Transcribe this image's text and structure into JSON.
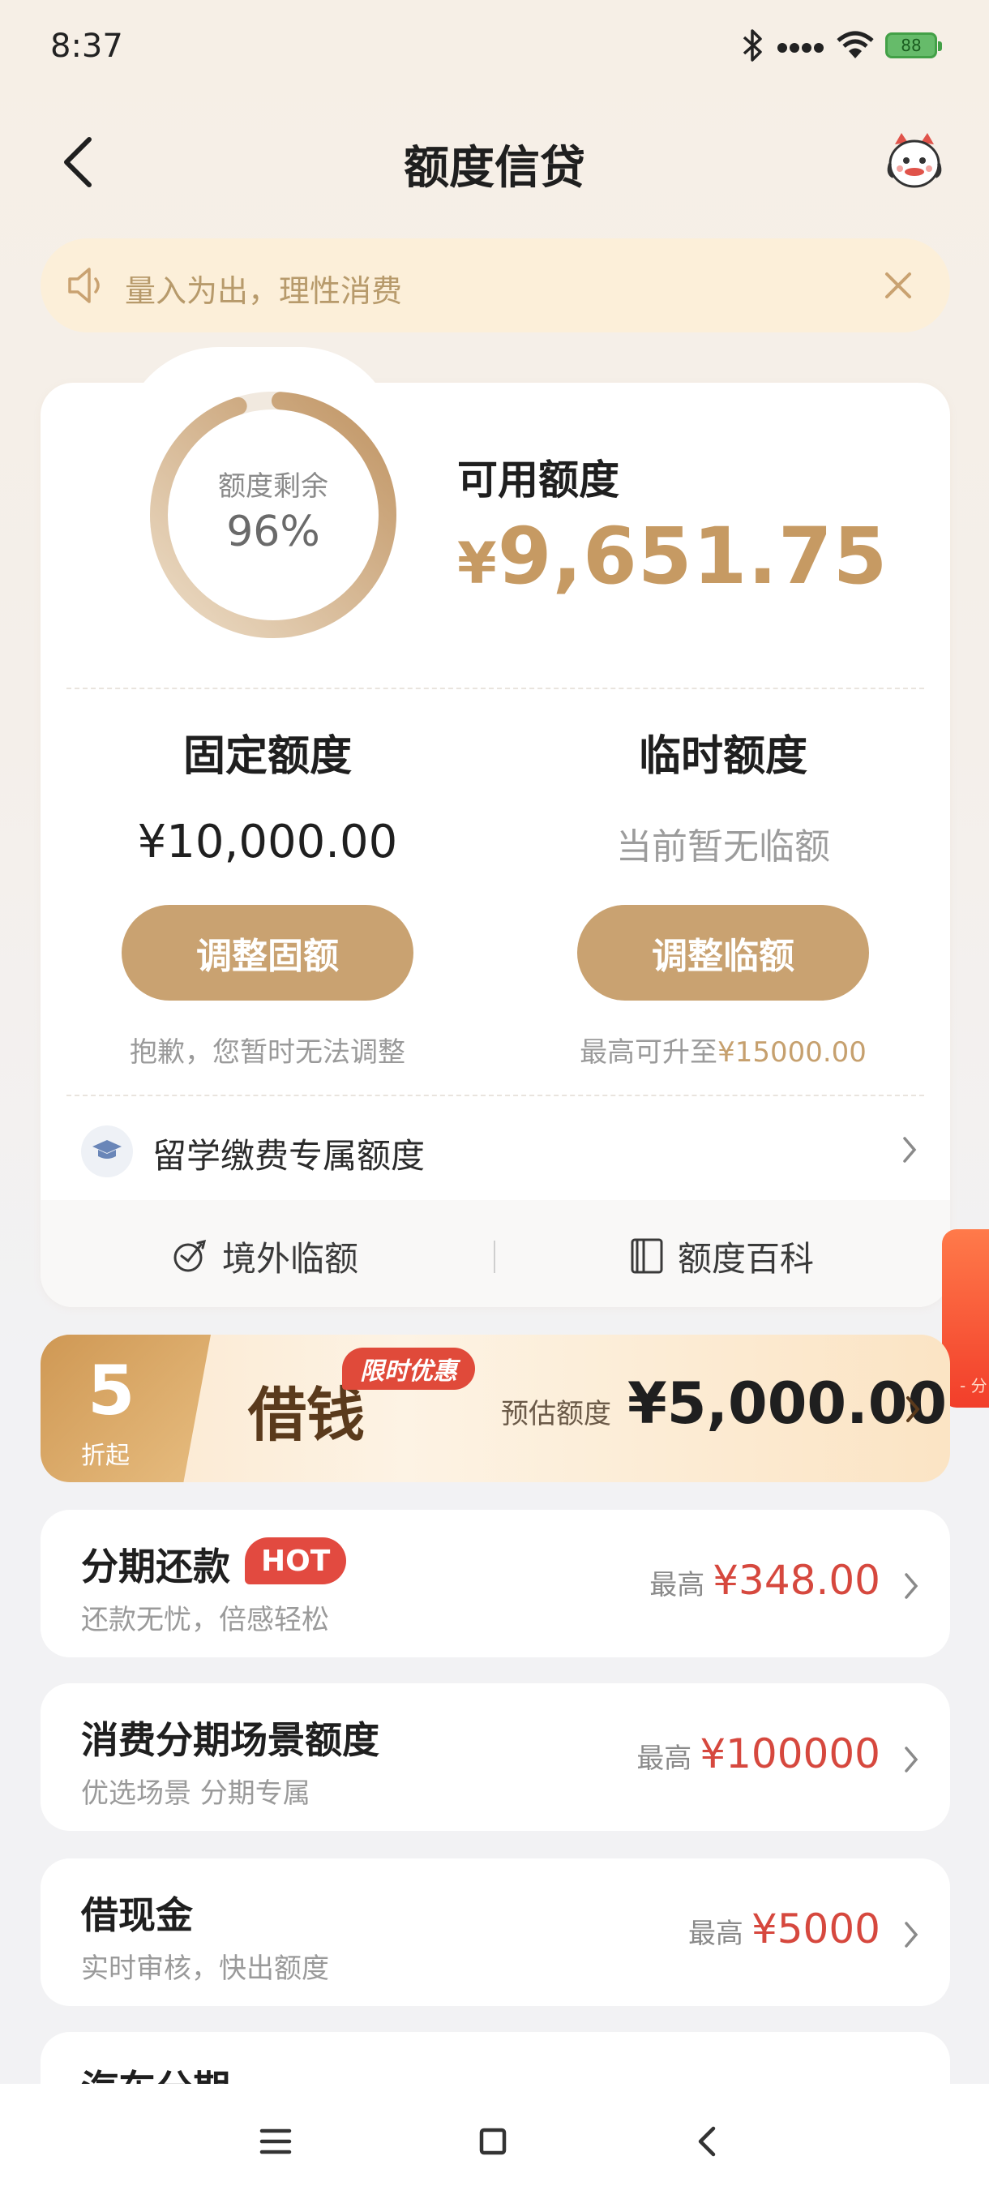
{
  "status_bar": {
    "time": "8:37",
    "battery": "88"
  },
  "header": {
    "title": "额度信贷"
  },
  "notice": {
    "text": "量入为出，理性消费"
  },
  "credit": {
    "ring_label": "额度剩余",
    "ring_percent": "96%",
    "ring_fraction": 0.96,
    "available_title": "可用额度",
    "available_currency": "¥",
    "available_amount": "9,651.75",
    "fixed_title": "固定额度",
    "fixed_amount": "¥10,000.00",
    "fixed_button": "调整固额",
    "fixed_hint": "抱歉，您暂时无法调整",
    "temp_title": "临时额度",
    "temp_status": "当前暂无临额",
    "temp_button": "调整临额",
    "temp_hint_prefix": "最高可升至",
    "temp_hint_amount": "¥15000.00",
    "study_label": "留学缴费专属额度",
    "overseas_link": "境外临额",
    "wiki_link": "额度百科"
  },
  "side_tab": {
    "text": "- 分"
  },
  "borrow": {
    "discount_number": "5",
    "discount_sub": "折起",
    "title": "借钱",
    "promo_tag": "限时优惠",
    "estimate_label": "预估额度",
    "estimate_amount": "¥5,000.00"
  },
  "products": [
    {
      "title": "分期还款",
      "badge": "HOT",
      "subtitle": "还款无忧，倍感轻松",
      "max_label": "最高",
      "amount": "¥348.00"
    },
    {
      "title": "消费分期场景额度",
      "subtitle": "优选场景 分期专属",
      "max_label": "最高",
      "amount": "¥100000"
    },
    {
      "title": "借现金",
      "subtitle": "实时审核，快出额度",
      "max_label": "最高",
      "amount": "¥5000"
    },
    {
      "title": "汽车分期"
    }
  ],
  "colors": {
    "gold": "#c9a271",
    "red": "#d6483e",
    "notice_bg": "#fcefd9"
  }
}
